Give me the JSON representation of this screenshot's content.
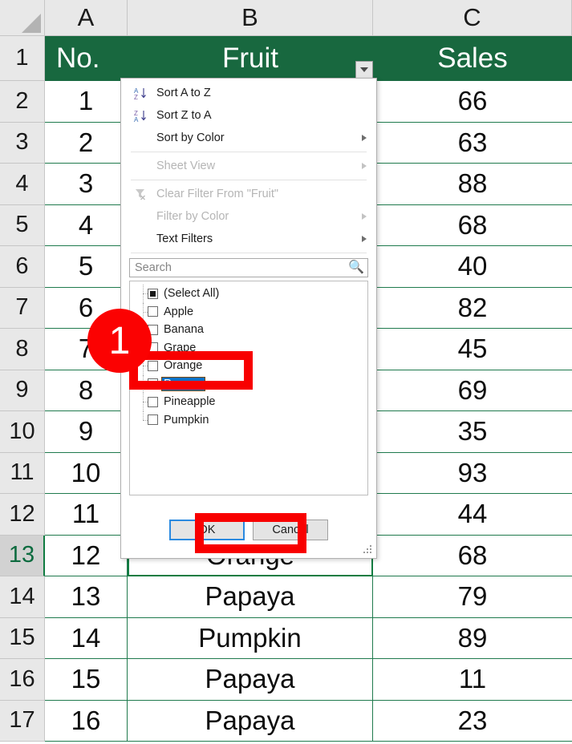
{
  "app": "excel-filter-dropdown",
  "grid": {
    "column_headers": [
      "A",
      "B",
      "C"
    ],
    "row_headers": [
      "1",
      "2",
      "3",
      "4",
      "5",
      "6",
      "7",
      "8",
      "9",
      "10",
      "11",
      "12",
      "13",
      "14",
      "15",
      "16",
      "17"
    ],
    "active_row": "13",
    "header_row": {
      "a": "No.",
      "b": "Fruit",
      "c": "Sales"
    },
    "header_fill": "#18683f",
    "header_text_color": "#ffffff",
    "gridline_color": "#1f7a4d",
    "rows": [
      {
        "row": "2",
        "no": "1",
        "fruit": "",
        "sales": "66"
      },
      {
        "row": "3",
        "no": "2",
        "fruit": "",
        "sales": "63"
      },
      {
        "row": "4",
        "no": "3",
        "fruit": "",
        "sales": "88"
      },
      {
        "row": "5",
        "no": "4",
        "fruit": "",
        "sales": "68"
      },
      {
        "row": "6",
        "no": "5",
        "fruit": "",
        "sales": "40"
      },
      {
        "row": "7",
        "no": "6",
        "fruit": "",
        "sales": "82"
      },
      {
        "row": "8",
        "no": "7",
        "fruit": "",
        "sales": "45"
      },
      {
        "row": "9",
        "no": "8",
        "fruit": "",
        "sales": "69"
      },
      {
        "row": "10",
        "no": "9",
        "fruit": "",
        "sales": "35"
      },
      {
        "row": "11",
        "no": "10",
        "fruit": "",
        "sales": "93"
      },
      {
        "row": "12",
        "no": "11",
        "fruit": "",
        "sales": "44"
      },
      {
        "row": "13",
        "no": "12",
        "fruit": "Orange",
        "sales": "68"
      },
      {
        "row": "14",
        "no": "13",
        "fruit": "Papaya",
        "sales": "79"
      },
      {
        "row": "15",
        "no": "14",
        "fruit": "Pumpkin",
        "sales": "89"
      },
      {
        "row": "16",
        "no": "15",
        "fruit": "Papaya",
        "sales": "11"
      },
      {
        "row": "17",
        "no": "16",
        "fruit": "Papaya",
        "sales": "23"
      }
    ]
  },
  "filter_dropdown": {
    "menu_items": [
      {
        "label": "Sort A to Z",
        "icon": "sort-az-icon",
        "disabled": false,
        "submenu": false
      },
      {
        "label": "Sort Z to A",
        "icon": "sort-za-icon",
        "disabled": false,
        "submenu": false
      },
      {
        "label": "Sort by Color",
        "icon": "",
        "disabled": false,
        "submenu": true
      },
      {
        "label": "Sheet View",
        "icon": "",
        "disabled": true,
        "submenu": true
      },
      {
        "label": "Clear Filter From \"Fruit\"",
        "icon": "clear-filter-icon",
        "disabled": true,
        "submenu": false
      },
      {
        "label": "Filter by Color",
        "icon": "",
        "disabled": true,
        "submenu": true
      },
      {
        "label": "Text Filters",
        "icon": "",
        "disabled": false,
        "submenu": true
      }
    ],
    "search": {
      "placeholder": "Search",
      "value": "",
      "icon": "search-icon"
    },
    "list_items": [
      {
        "label": "(Select All)",
        "state": "partial",
        "selected": false
      },
      {
        "label": "Apple",
        "state": "unchecked",
        "selected": false
      },
      {
        "label": "Banana",
        "state": "unchecked",
        "selected": false
      },
      {
        "label": "Grape",
        "state": "unchecked",
        "selected": false
      },
      {
        "label": "Orange",
        "state": "unchecked",
        "selected": false
      },
      {
        "label": "Papaya",
        "state": "checked",
        "selected": true
      },
      {
        "label": "Pineapple",
        "state": "unchecked",
        "selected": false
      },
      {
        "label": "Pumpkin",
        "state": "unchecked",
        "selected": false
      }
    ],
    "ok_label": "OK",
    "cancel_label": "Cancel"
  },
  "annotations": {
    "badge_1": "1",
    "badge_color": "#fb0202",
    "highlight_color": "#f80000"
  }
}
